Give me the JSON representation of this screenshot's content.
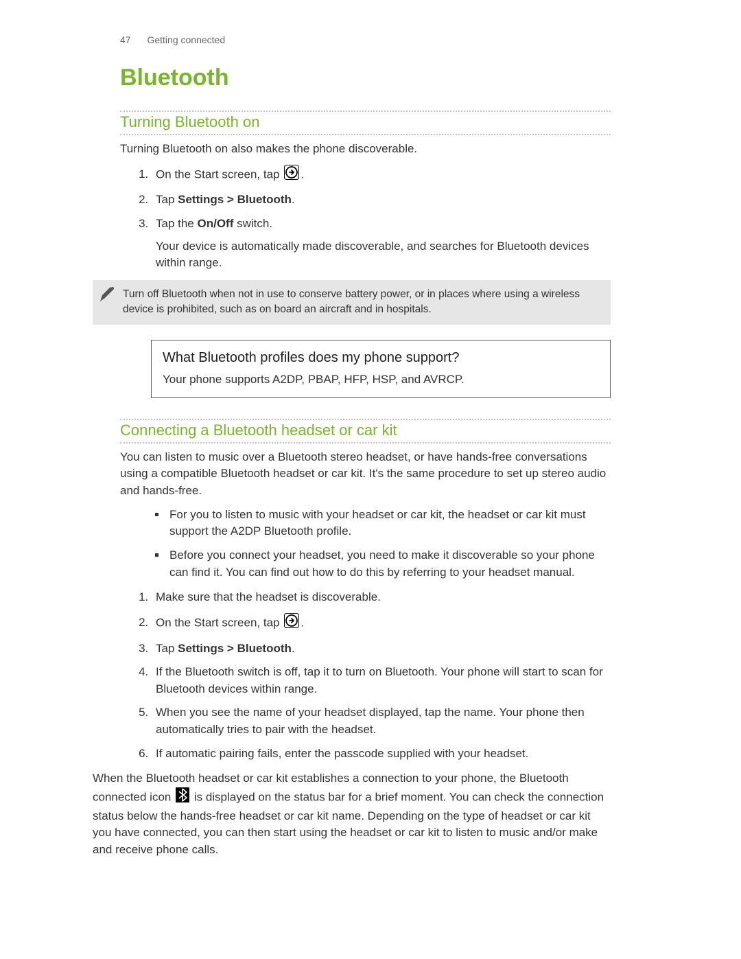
{
  "header": {
    "page_num": "47",
    "breadcrumb": "Getting connected"
  },
  "title": "Bluetooth",
  "section1": {
    "heading": "Turning Bluetooth on",
    "intro": "Turning Bluetooth on also makes the phone discoverable.",
    "step1_text": "On the Start screen, tap ",
    "step1_tail": ".",
    "step2_prefix": "Tap ",
    "step2_strong": "Settings > Bluetooth",
    "step2_tail": ".",
    "step3_prefix": "Tap the ",
    "step3_strong": "On/Off",
    "step3_tail": " switch.",
    "step3_sub": "Your device is automatically made discoverable, and searches for Bluetooth devices within range."
  },
  "note": "Turn off Bluetooth when not in use to conserve battery power, or in places where using a wireless device is prohibited, such as on board an aircraft and in hospitals.",
  "faq": {
    "question": "What Bluetooth profiles does my phone support?",
    "answer": "Your phone supports A2DP, PBAP, HFP, HSP, and AVRCP."
  },
  "section2": {
    "heading": "Connecting a Bluetooth headset or car kit",
    "intro": "You can listen to music over a Bluetooth stereo headset, or have hands-free conversations using a compatible Bluetooth headset or car kit. It's the same procedure to set up stereo audio and hands-free.",
    "bullet1": "For you to listen to music with your headset or car kit, the headset or car kit must support the A2DP Bluetooth profile.",
    "bullet2": "Before you connect your headset, you need to make it discoverable so your phone can find it. You can find out how to do this by referring to your headset manual.",
    "step1": "Make sure that the headset is discoverable.",
    "step2_text": "On the Start screen, tap ",
    "step2_tail": ".",
    "step3_prefix": "Tap ",
    "step3_strong": "Settings > Bluetooth",
    "step3_tail": ".",
    "step4": "If the Bluetooth switch is off, tap it to turn on Bluetooth. Your phone will start to scan for Bluetooth devices within range.",
    "step5": "When you see the name of your headset displayed, tap the name. Your phone then automatically tries to pair with the headset.",
    "step6": "If automatic pairing fails, enter the passcode supplied with your headset.",
    "outro_a": "When the Bluetooth headset or car kit establishes a connection to your phone, the Bluetooth connected icon ",
    "outro_b": " is displayed on the status bar for a brief moment. You can check the connection status below the hands-free headset or car kit name. Depending on the type of headset or car kit you have connected, you can then start using the headset or car kit to listen to music and/or make and receive phone calls."
  }
}
